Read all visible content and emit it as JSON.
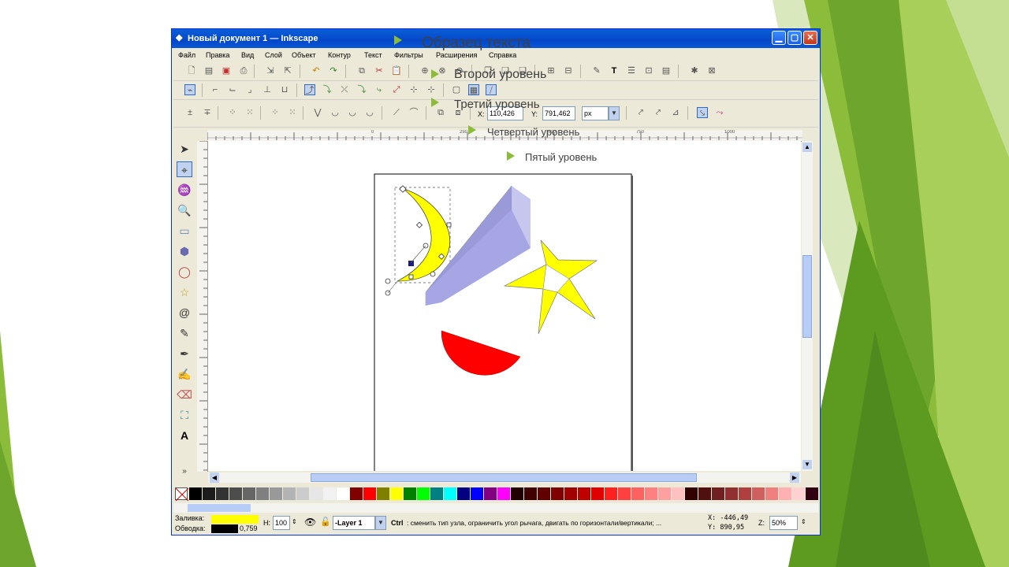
{
  "window": {
    "title": "Новый документ 1 — Inkscape",
    "title_icon": "inkscape-logo-icon",
    "buttons": [
      "minimize-icon",
      "maximize-icon",
      "close-icon"
    ]
  },
  "menu": [
    "Файл",
    "Правка",
    "Вид",
    "Слой",
    "Объект",
    "Контур",
    "Текст",
    "Фильтры",
    "Расширения",
    "Справка"
  ],
  "node_toolbar": {
    "x_label": "X:",
    "x_value": "110,426",
    "y_label": "Y:",
    "y_value": "791,462",
    "unit": "px"
  },
  "ruler": {
    "ticks": [
      "0",
      "250",
      "500",
      "750",
      "1000"
    ]
  },
  "status": {
    "fill_label": "Заливка:",
    "stroke_label": "Обводка:",
    "fill_color": "#ffff00",
    "stroke_color": "#000000",
    "stroke_width": "0,759",
    "h_label": "H:",
    "h_value": "100",
    "layer": "-Layer 1",
    "message_key": "Ctrl",
    "message": ": сменить тип узла, ограничить угол рычага, двигать по горизонтали/вертикали; ...",
    "x_coord": "X: -446,49",
    "y_coord": "Y: 890,95",
    "zoom_label": "Z:",
    "zoom_value": "50%"
  },
  "palette": [
    "#000000",
    "#1c1c1c",
    "#333333",
    "#4d4d4d",
    "#666666",
    "#808080",
    "#999999",
    "#b3b3b3",
    "#cccccc",
    "#e6e6e6",
    "#f2f2f2",
    "#ffffff",
    "#800000",
    "#ff0000",
    "#808000",
    "#ffff00",
    "#008000",
    "#00ff00",
    "#008080",
    "#00ffff",
    "#000080",
    "#0000ff",
    "#800080",
    "#ff00ff",
    "#200000",
    "#400000",
    "#600000",
    "#800000",
    "#a00000",
    "#c00000",
    "#e00000",
    "#ff2020",
    "#ff4040",
    "#ff6060",
    "#ff8080",
    "#ffa0a0",
    "#ffc0c0",
    "#300000",
    "#501010",
    "#702020",
    "#903030",
    "#b04040",
    "#d06060",
    "#f08080",
    "#ffb0b0",
    "#ffd0d0",
    "#300010"
  ],
  "slide_outline": [
    {
      "text": "Образец текста"
    },
    {
      "text": "Второй уровень"
    },
    {
      "text": "Третий уровень"
    },
    {
      "text": "Четвертый уровень"
    },
    {
      "text": "Пятый уровень"
    }
  ],
  "accent_colors": {
    "green": "#8cbd3a",
    "dark_green": "#4e8a1e"
  }
}
